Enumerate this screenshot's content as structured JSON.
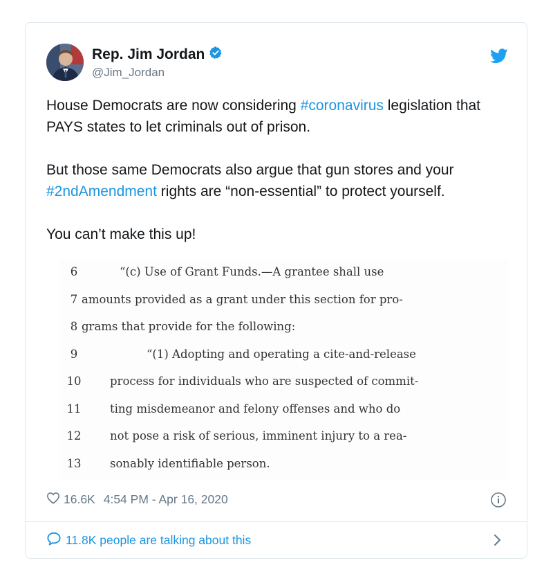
{
  "author": {
    "name": "Rep. Jim Jordan",
    "handle": "@Jim_Jordan"
  },
  "tweet": {
    "p1_before": "House Democrats are now considering ",
    "p1_hashtag": "#coronavirus",
    "p1_after": " legislation that PAYS states to let criminals out of prison.",
    "p2_before": "But those same Democrats also argue that gun stores and your ",
    "p2_hashtag": "#2ndAmendment",
    "p2_after": " rights are “non-essential” to protect yourself.",
    "p3": "You can’t make this up!"
  },
  "document_image": {
    "lines": [
      {
        "num": "6",
        "text": "“(c) Use of Grant Funds.—A grantee shall use"
      },
      {
        "num": "7",
        "text": "amounts provided as a grant under this section for pro-"
      },
      {
        "num": "8",
        "text": "grams that provide for the following:"
      },
      {
        "num": "9",
        "text": "“(1) Adopting and operating a cite-and-release"
      },
      {
        "num": "10",
        "text": "process for individuals who are suspected of commit-"
      },
      {
        "num": "11",
        "text": "ting misdemeanor and felony offenses and who do"
      },
      {
        "num": "12",
        "text": "not pose a risk of serious, imminent injury to a rea-"
      },
      {
        "num": "13",
        "text": "sonably identifiable person."
      }
    ]
  },
  "meta": {
    "likes": "16.6K",
    "timestamp": "4:54 PM - Apr 16, 2020"
  },
  "conversation": {
    "label": "11.8K people are talking about this"
  },
  "icons": {
    "verified": "verified-badge-icon",
    "logo": "twitter-bird-icon",
    "like": "heart-icon",
    "info": "info-icon",
    "reply": "speech-bubble-icon",
    "chevron": "chevron-right-icon"
  },
  "colors": {
    "accent": "#1b95e0",
    "text": "#14171a",
    "secondary": "#657786",
    "border": "#e1e8ed"
  }
}
